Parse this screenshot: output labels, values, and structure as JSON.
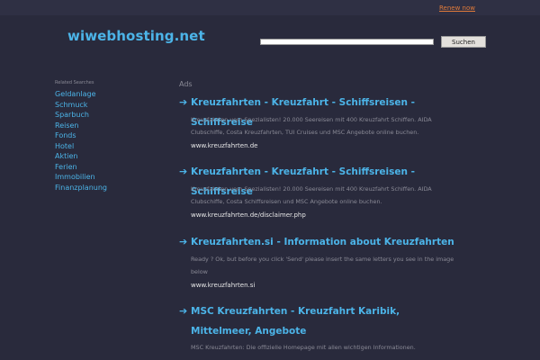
{
  "top": {
    "renew": "Renew now"
  },
  "header": {
    "logo": "wiwebhosting.net",
    "search_placeholder": "",
    "search_button": "Suchen"
  },
  "sidebar": {
    "title": "Related Searches",
    "items": [
      "Geldanlage",
      "Schmuck",
      "Sparbuch",
      "Reisen",
      "Fonds",
      "Hotel",
      "Aktien",
      "Ferien",
      "Immobilien",
      "Finanzplanung"
    ]
  },
  "ads_label": "Ads",
  "ads": [
    {
      "title": "Kreuzfahrten - Kreuzfahrt - Schiffsreisen - Schiffsreise",
      "desc": "Kreuzfahrten vom Spezialisten! 20.000 Seereisen mit 400 Kreuzfahrt Schiffen. AIDA Clubschiffe, Costa Kreuzfahrten, TUI Cruises und MSC Angebote online buchen.",
      "url": "www.kreuzfahrten.de"
    },
    {
      "title": "Kreuzfahrten - Kreuzfahrt - Schiffsreisen - Schiffsreise",
      "desc": "Kreuzfahrten vom Spezialisten! 20.000 Seereisen mit 400 Kreuzfahrt Schiffen. AIDA Clubschiffe, Costa Schiffsreisen und MSC Angebote online buchen.",
      "url": "www.kreuzfahrten.de/disclaimer.php"
    },
    {
      "title": "Kreuzfahrten.si - Information about Kreuzfahrten",
      "desc": "Ready ? Ok, but before you click 'Send' please insert the same letters you see in the image below",
      "url": "www.kreuzfahrten.si"
    },
    {
      "title": "MSC Kreuzfahrten - Kreuzfahrt Karibik, Mittelmeer, Angebote",
      "desc": "MSC Kreuzfahrten: Die offizielle Homepage mit allen wichtigen Informationen.",
      "url": ""
    }
  ],
  "icons": {
    "ad_arrow": "arrow-right-icon"
  },
  "colors": {
    "background": "#292a3c",
    "link": "#4cb4e8",
    "renew": "#e07a3a",
    "muted": "#8a8a96"
  }
}
